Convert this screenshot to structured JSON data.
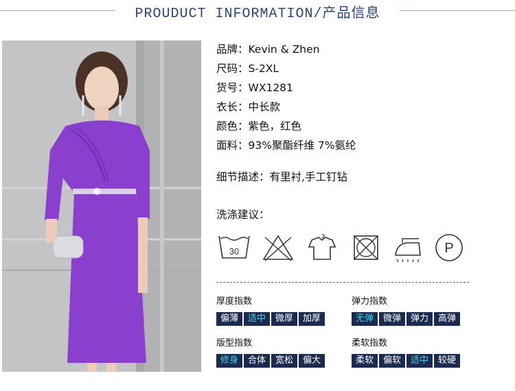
{
  "header": {
    "title": "PROUDUCT INFORMATION/产品信息"
  },
  "specs": [
    {
      "label": "品牌：",
      "value": "Kevin & Zhen"
    },
    {
      "label": "尺码：",
      "value": "S-2XL"
    },
    {
      "label": "货号：",
      "value": "WX1281"
    },
    {
      "label": "衣长：",
      "value": "中长款"
    },
    {
      "label": "颜色：",
      "value": "紫色，红色"
    },
    {
      "label": "面料：",
      "value": "93%聚酯纤维 7%氨纶"
    }
  ],
  "detail": {
    "label": "细节描述：",
    "value": "有里衬,手工钉钻"
  },
  "care": {
    "title": "洗涤建议：",
    "icons": [
      {
        "name": "wash-30-icon",
        "text": "30"
      },
      {
        "name": "no-bleach-icon"
      },
      {
        "name": "hang-dry-icon"
      },
      {
        "name": "no-tumble-dry-icon"
      },
      {
        "name": "iron-icon"
      },
      {
        "name": "dry-clean-p-icon",
        "text": "P"
      }
    ]
  },
  "indices": [
    {
      "title": "厚度指数",
      "options": [
        "偏薄",
        "适中",
        "微厚",
        "加厚"
      ],
      "selected": 1
    },
    {
      "title": "弹力指数",
      "options": [
        "无弹",
        "微弹",
        "弹力",
        "高弹"
      ],
      "selected": 0
    },
    {
      "title": "版型指数",
      "options": [
        "修身",
        "合体",
        "宽松",
        "偏大"
      ],
      "selected": 0
    },
    {
      "title": "柔软指数",
      "options": [
        "柔软",
        "偏软",
        "适中",
        "较硬"
      ],
      "selected": 2
    }
  ],
  "colors": {
    "header_text": "#2c4476",
    "index_cell_bg": "#1b2a4e",
    "index_selected_text": "#3fd4e6",
    "dress_purple": "#8a3fcf"
  }
}
